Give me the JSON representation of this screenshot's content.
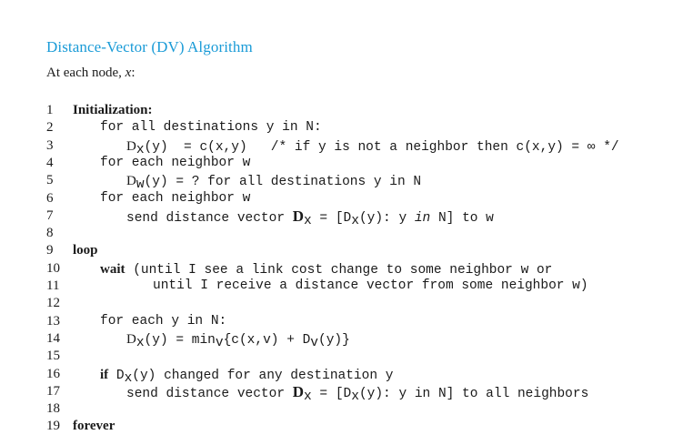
{
  "title": "Distance-Vector (DV) Algorithm",
  "subtitle_prefix": "At each node, ",
  "subtitle_var": "x",
  "subtitle_suffix": ":",
  "line_numbers": [
    "1",
    "2",
    "3",
    "4",
    "5",
    "6",
    "7",
    "8",
    "9",
    "10",
    "11",
    "12",
    "13",
    "14",
    "15",
    "16",
    "17",
    "18",
    "19"
  ],
  "code": {
    "l1": "Initialization:",
    "l2": "for all destinations y in N:",
    "l3_a": "D",
    "l3_sub": "x",
    "l3_b": "(y)  = c(x,y)   /* if y is not a neighbor then c(x,y) = ∞ */",
    "l4": "for each neighbor w",
    "l5_a": "D",
    "l5_sub": "w",
    "l5_b": "(y) = ? for all destinations y in N",
    "l6": "for each neighbor w",
    "l7_a": "send distance vector ",
    "l7_D": "D",
    "l7_sub": "x",
    "l7_b": " = [D",
    "l7_sub2": "x",
    "l7_c": "(y): y ",
    "l7_in": "in",
    "l7_d": " N] to w",
    "l9": "loop",
    "l10_kw": "wait",
    "l10_b": " (until I see a link cost change to some neighbor w or",
    "l11": "until I receive a distance vector from some neighbor w)",
    "l13": "for each y in N:",
    "l14_a": "D",
    "l14_sub": "x",
    "l14_b": "(y) = min",
    "l14_sub2": "v",
    "l14_c": "{c(x,v) + D",
    "l14_sub3": "v",
    "l14_d": "(y)}",
    "l16_kw": "if",
    "l16_a": " D",
    "l16_sub": "x",
    "l16_b": "(y) changed for any destination y",
    "l17_a": "send distance vector ",
    "l17_D": "D",
    "l17_sub": "x",
    "l17_b": " = [D",
    "l17_sub2": "x",
    "l17_c": "(y): y in N] to all neighbors",
    "l19": "forever"
  }
}
